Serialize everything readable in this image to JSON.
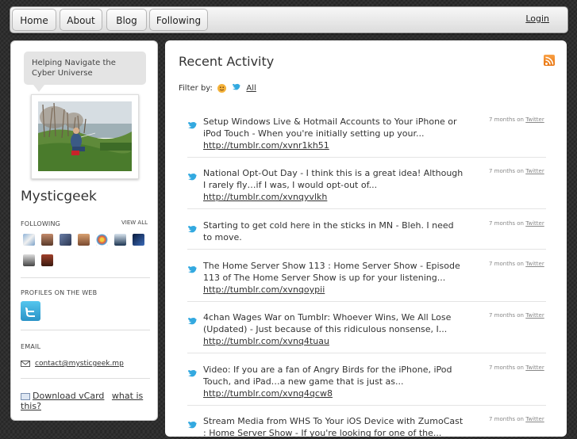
{
  "nav": {
    "items": [
      {
        "label": "Home"
      },
      {
        "label": "About"
      },
      {
        "label": "Blog"
      },
      {
        "label": "Following"
      }
    ],
    "login_label": "Login"
  },
  "profile": {
    "tagline": "Helping Navigate the Cyber Universe",
    "name": "Mysticgeek",
    "following_label": "FOLLOWING",
    "view_all_label": "VIEW ALL",
    "profiles_label": "PROFILES ON THE WEB",
    "email_label": "EMAIL",
    "email": "contact@mysticgeek.mp",
    "vcard_label": "Download vCard",
    "what_label": "what is this?"
  },
  "main": {
    "title": "Recent Activity",
    "filter_label": "Filter by:",
    "filter_all": "All",
    "source": "Twitter",
    "items": [
      {
        "text": "Setup Windows Live & Hotmail Accounts to Your iPhone or iPod Touch - When you're initially setting up your...",
        "link": "http://tumblr.com/xvnr1kh51",
        "time": "7 months on"
      },
      {
        "text": "National Opt-Out Day - I think this is a great idea! Although I rarely fly…if I was, I would opt-out of...",
        "link": "http://tumblr.com/xvnqyvlkh",
        "time": "7 months on"
      },
      {
        "text": "Starting to get cold here in the sticks in MN - Bleh. I need to move.",
        "link": "",
        "time": "7 months on"
      },
      {
        "text": "The Home Server Show 113 : Home Server Show - Episode 113 of The Home Server Show is up for your listening...",
        "link": "http://tumblr.com/xvnqoypii",
        "time": "7 months on"
      },
      {
        "text": "4chan Wages War on Tumblr: Whoever Wins, We All Lose (Updated) - Just because of this ridiculous nonsense, I...",
        "link": "http://tumblr.com/xvnq4tuau",
        "time": "7 months on"
      },
      {
        "text": "Video: If you are a fan of Angry Birds for the iPhone, iPod Touch, and iPad…a new game that is just as...",
        "link": "http://tumblr.com/xvnq4qcw8",
        "time": "7 months on"
      },
      {
        "text": "Stream Media from WHS To Your iOS Device with ZumoCast : Home Server Show - If you're looking for one of the...",
        "link": "",
        "time": "7 months on"
      }
    ]
  },
  "colors": {
    "twitter_blue": "#33a9e0",
    "rss_orange": "#f08a24",
    "background": "#2e2e2e"
  },
  "icons": {
    "bird": "twitter-bird-icon",
    "rss": "rss-icon",
    "mail": "mail-icon",
    "vcard": "vcard-icon",
    "smiley": "smiley-icon"
  }
}
